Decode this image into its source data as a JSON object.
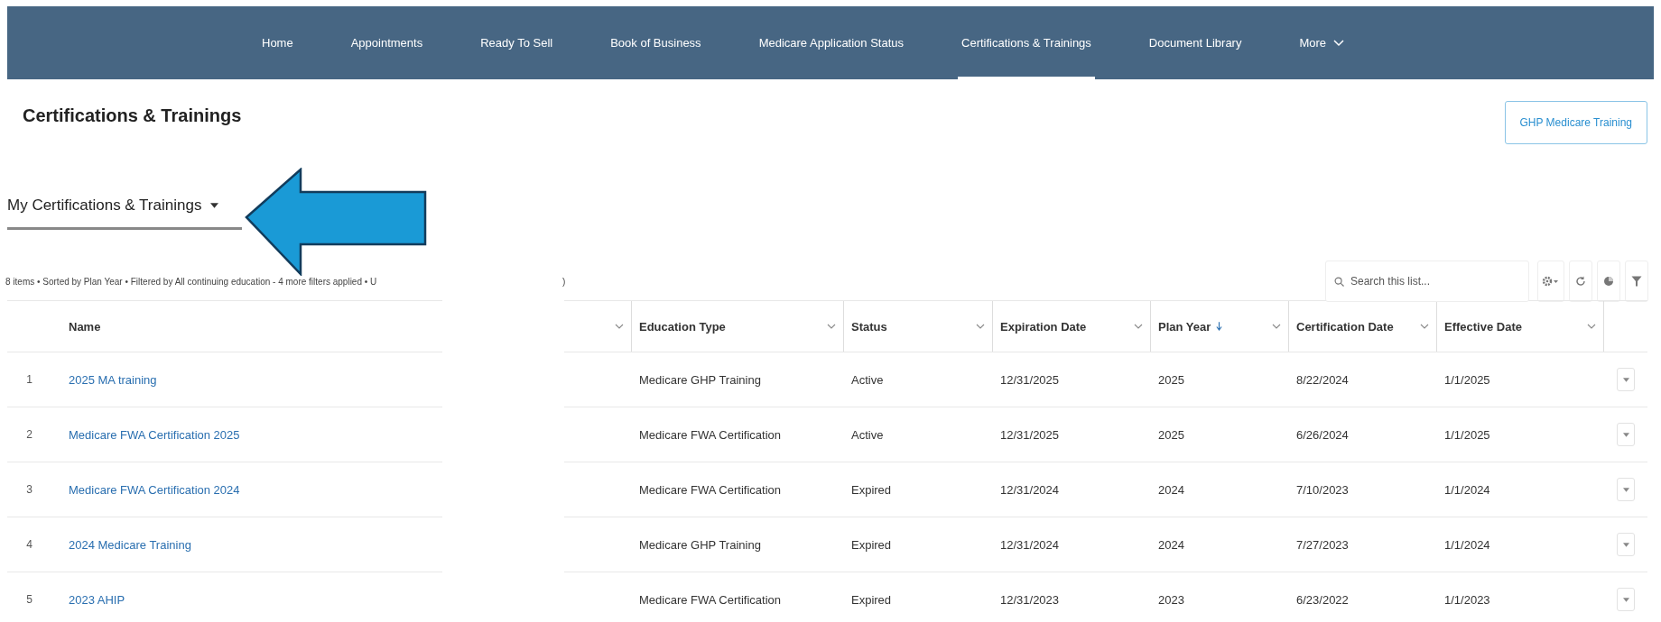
{
  "nav": [
    {
      "label": "Home",
      "kind": "link",
      "selected": false
    },
    {
      "label": "Appointments",
      "kind": "link",
      "selected": false
    },
    {
      "label": "Ready To Sell",
      "kind": "link",
      "selected": false
    },
    {
      "label": "Book of Business",
      "kind": "link",
      "selected": false
    },
    {
      "label": "Medicare Application Status",
      "kind": "link",
      "selected": false
    },
    {
      "label": "Certifications & Trainings",
      "kind": "link",
      "selected": true
    },
    {
      "label": "Document Library",
      "kind": "link",
      "selected": false
    },
    {
      "label": "More",
      "kind": "menu",
      "selected": false
    }
  ],
  "page_title": "Certifications & Trainings",
  "header_button": "GHP Medicare Training",
  "list_view": {
    "title": "My Certifications & Trainings",
    "meta": "8 items • Sorted by Plan Year • Filtered by All continuing education - 4 more filters applied • U",
    "meta_tail": ")"
  },
  "search": {
    "placeholder": "Search this list..."
  },
  "table": {
    "columns": [
      {
        "label": "Name",
        "sorted": false
      },
      {
        "label": "Education Type",
        "sorted": false
      },
      {
        "label": "Status",
        "sorted": false
      },
      {
        "label": "Expiration Date",
        "sorted": false
      },
      {
        "label": "Plan Year",
        "sorted": true
      },
      {
        "label": "Certification Date",
        "sorted": false
      },
      {
        "label": "Effective Date",
        "sorted": false
      }
    ],
    "rows": [
      {
        "number": "1",
        "name": "2025 MA training",
        "education_type": "Medicare GHP Training",
        "status": "Active",
        "expiration_date": "12/31/2025",
        "plan_year": "2025",
        "certification_date": "8/22/2024",
        "effective_date": "1/1/2025"
      },
      {
        "number": "2",
        "name": "Medicare FWA Certification 2025",
        "education_type": "Medicare FWA Certification",
        "status": "Active",
        "expiration_date": "12/31/2025",
        "plan_year": "2025",
        "certification_date": "6/26/2024",
        "effective_date": "1/1/2025"
      },
      {
        "number": "3",
        "name": "Medicare FWA Certification 2024",
        "education_type": "Medicare FWA Certification",
        "status": "Expired",
        "expiration_date": "12/31/2024",
        "plan_year": "2024",
        "certification_date": "7/10/2023",
        "effective_date": "1/1/2024"
      },
      {
        "number": "4",
        "name": "2024 Medicare Training",
        "education_type": "Medicare GHP Training",
        "status": "Expired",
        "expiration_date": "12/31/2024",
        "plan_year": "2024",
        "certification_date": "7/27/2023",
        "effective_date": "1/1/2024"
      },
      {
        "number": "5",
        "name": "2023 AHIP",
        "education_type": "Medicare FWA Certification",
        "status": "Expired",
        "expiration_date": "12/31/2023",
        "plan_year": "2023",
        "certification_date": "6/23/2022",
        "effective_date": "1/1/2023"
      }
    ]
  }
}
